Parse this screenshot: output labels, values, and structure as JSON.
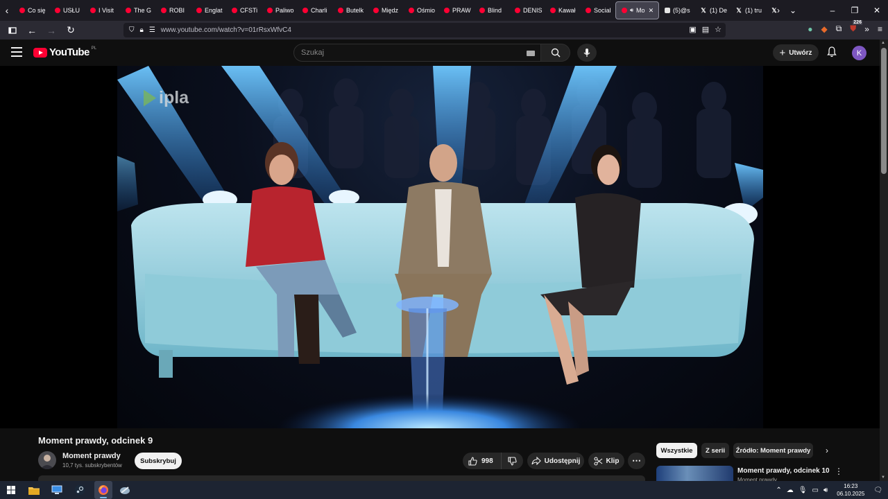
{
  "browser": {
    "tabs": [
      {
        "label": "Co się",
        "icon": "youtube"
      },
      {
        "label": "USŁU",
        "icon": "youtube"
      },
      {
        "label": "I Visit",
        "icon": "youtube"
      },
      {
        "label": "The G",
        "icon": "youtube"
      },
      {
        "label": "ROBI",
        "icon": "youtube"
      },
      {
        "label": "Englat",
        "icon": "youtube"
      },
      {
        "label": "CFSTi",
        "icon": "youtube"
      },
      {
        "label": "Paliwo",
        "icon": "youtube"
      },
      {
        "label": "Charli",
        "icon": "youtube"
      },
      {
        "label": "Butelk",
        "icon": "youtube"
      },
      {
        "label": "Międz",
        "icon": "youtube"
      },
      {
        "label": "Ośmio",
        "icon": "youtube"
      },
      {
        "label": "PRAW",
        "icon": "youtube"
      },
      {
        "label": "Blind",
        "icon": "youtube"
      },
      {
        "label": "DENIS",
        "icon": "youtube"
      },
      {
        "label": "Kawał",
        "icon": "youtube"
      },
      {
        "label": "Social",
        "icon": "youtube"
      }
    ],
    "active_tab": {
      "label": "Mo",
      "icon": "youtube"
    },
    "extra_tabs": [
      {
        "label": "(5)@s",
        "icon": "tiktok"
      },
      {
        "label": "(1) De",
        "icon": "x"
      },
      {
        "label": "(1) tru",
        "icon": "x"
      },
      {
        "label": "",
        "icon": "x"
      }
    ],
    "url": "www.youtube.com/watch?v=01rRsxWfvC4",
    "extensions_badge": "226"
  },
  "youtube": {
    "logo_text": "YouTube",
    "country_code": "PL",
    "search_placeholder": "Szukaj",
    "create_label": "Utwórz",
    "avatar_letter": "K"
  },
  "video": {
    "watermark": "ipla",
    "title": "Moment prawdy, odcinek 9",
    "channel_name": "Moment prawdy",
    "subscribers": "10,7 tys. subskrybentów",
    "subscribe_label": "Subskrybuj",
    "likes": "998",
    "share_label": "Udostępnij",
    "clip_label": "Klip"
  },
  "sidebar": {
    "chips": [
      "Wszystkie",
      "Z serii",
      "Źródło: Moment prawdy"
    ],
    "recommendation": {
      "title": "Moment prawdy, odcinek 10",
      "channel": "Moment prawdy"
    }
  },
  "taskbar": {
    "time": "16:23",
    "date": "06.10.2025"
  },
  "colors": {
    "youtube_red": "#ff0033",
    "page_bg": "#0f0f0f",
    "browser_chrome": "#1c1b22",
    "avatar_purple": "#7e57c2"
  }
}
